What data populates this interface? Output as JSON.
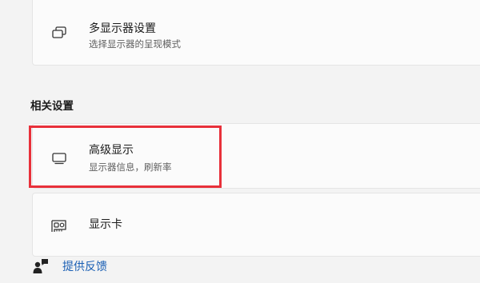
{
  "multi_display": {
    "title": "多显示器设置",
    "subtitle": "选择显示器的呈现模式",
    "icon": "multiple-displays-icon"
  },
  "related_settings": {
    "heading": "相关设置",
    "items": [
      {
        "title": "高级显示",
        "subtitle": "显示器信息，刷新率",
        "icon": "monitor-icon",
        "highlighted": true
      },
      {
        "title": "显示卡",
        "icon": "graphics-card-icon"
      }
    ]
  },
  "feedback": {
    "label": "提供反馈",
    "icon": "feedback-icon"
  },
  "colors": {
    "highlight": "#e8303a",
    "link": "#1a5fb4"
  }
}
